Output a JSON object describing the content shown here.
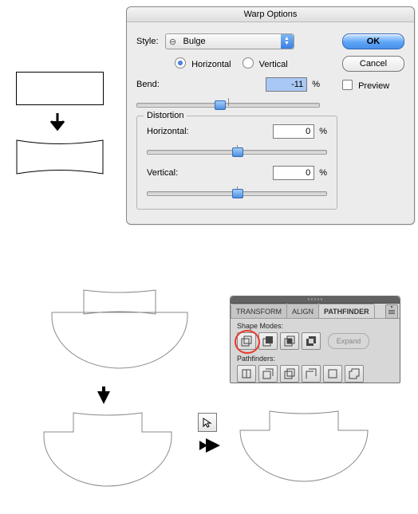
{
  "dialog": {
    "title": "Warp Options",
    "style_label": "Style:",
    "style_value": "Bulge",
    "horizontal_label": "Horizontal",
    "vertical_label": "Vertical",
    "orientation": "horizontal",
    "bend_label": "Bend:",
    "bend_value": "-11",
    "bend_unit": "%",
    "distortion": {
      "legend": "Distortion",
      "h_label": "Horizontal:",
      "h_value": "0",
      "h_unit": "%",
      "v_label": "Vertical:",
      "v_value": "0",
      "v_unit": "%"
    },
    "ok_label": "OK",
    "cancel_label": "Cancel",
    "preview_label": "Preview"
  },
  "panel": {
    "tabs": {
      "transform": "TRANSFORM",
      "align": "ALIGN",
      "pathfinder": "PATHFINDER"
    },
    "shape_modes_label": "Shape Modes:",
    "expand_label": "Expand",
    "pathfinders_label": "Pathfinders:"
  }
}
